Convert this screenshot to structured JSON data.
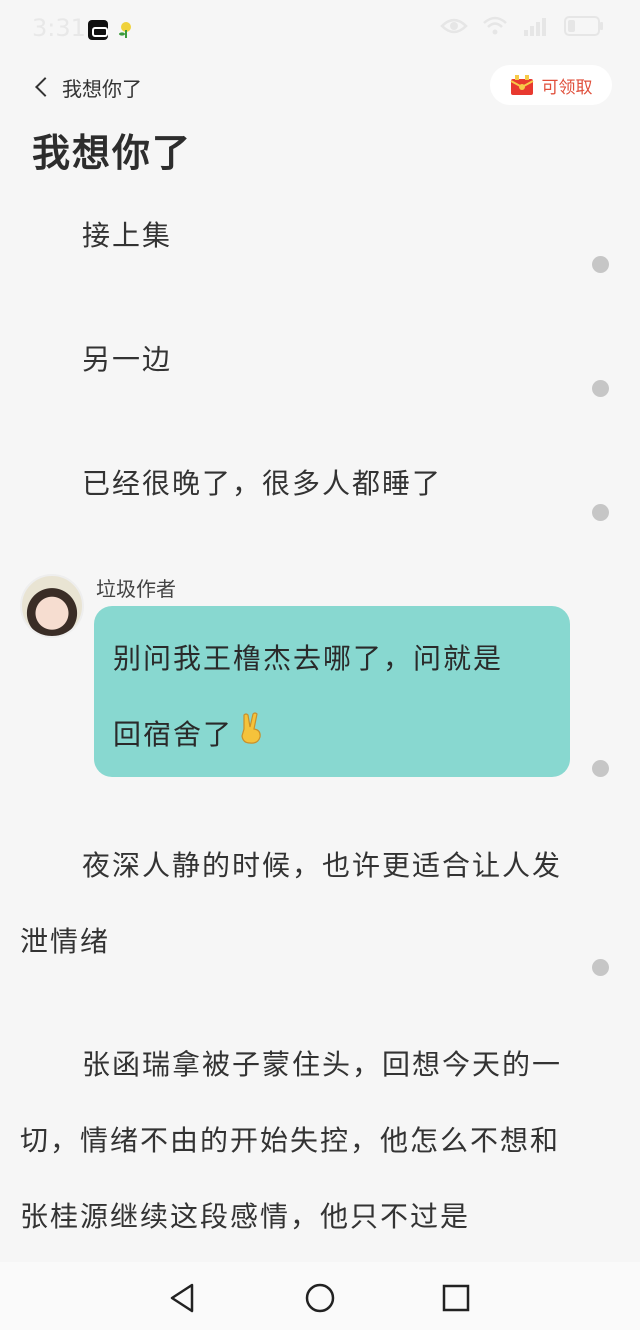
{
  "status_bar": {
    "time": "3:31"
  },
  "header": {
    "back_label": "我想你了",
    "claim_label": "可领取",
    "title": "我想你了"
  },
  "content": {
    "paragraphs": [
      "接上集",
      "另一边",
      "已经很晚了，很多人都睡了"
    ],
    "author_note": {
      "author": "垃圾作者",
      "line1": "别问我王橹杰去哪了，问就是",
      "line2": "回宿舍了",
      "emoji": "victory-hand-icon"
    },
    "paragraphs2": [
      "夜深人静的时候，也许更适合让人发泄情绪",
      "张函瑞拿被子蒙住头，回想今天的一切，情绪不由的开始失控，他怎么不想和张桂源继续这段感情，他只不过是"
    ]
  },
  "colors": {
    "background": "#f6f6f6",
    "bubble": "#88d8d0",
    "accent": "#e0503c",
    "dot": "#c6c6c6"
  }
}
